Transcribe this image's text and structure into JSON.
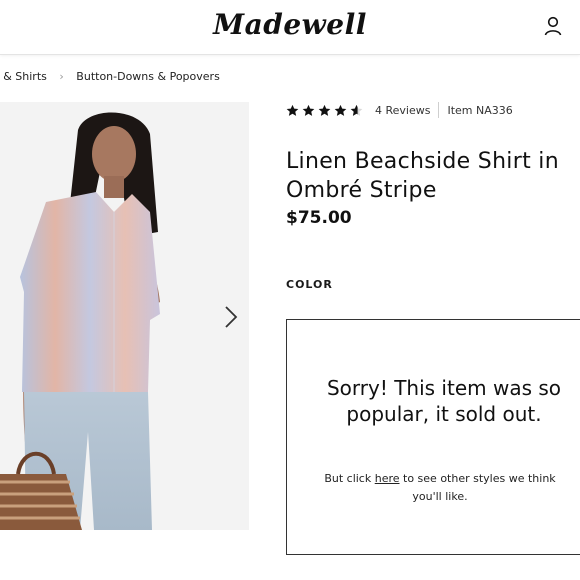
{
  "header": {
    "logo_text": "Madewell",
    "account_icon": "user-icon"
  },
  "breadcrumb": {
    "items": [
      "s & Shirts",
      "Button-Downs & Popovers"
    ]
  },
  "product": {
    "rating": 4.5,
    "stars_max": 5,
    "reviews_label": "4 Reviews",
    "item_number": "Item NA336",
    "title": "Linen Beachside Shirt in Ombré Stripe",
    "price": "$75.00",
    "color_label": "COLOR"
  },
  "gallery": {
    "next_icon": "chevron-right-icon"
  },
  "soldout": {
    "headline": "Sorry! This item was so popular, it sold out.",
    "sub_before": "But click ",
    "link_text": "here",
    "sub_after": " to see other styles we think you'll like."
  }
}
